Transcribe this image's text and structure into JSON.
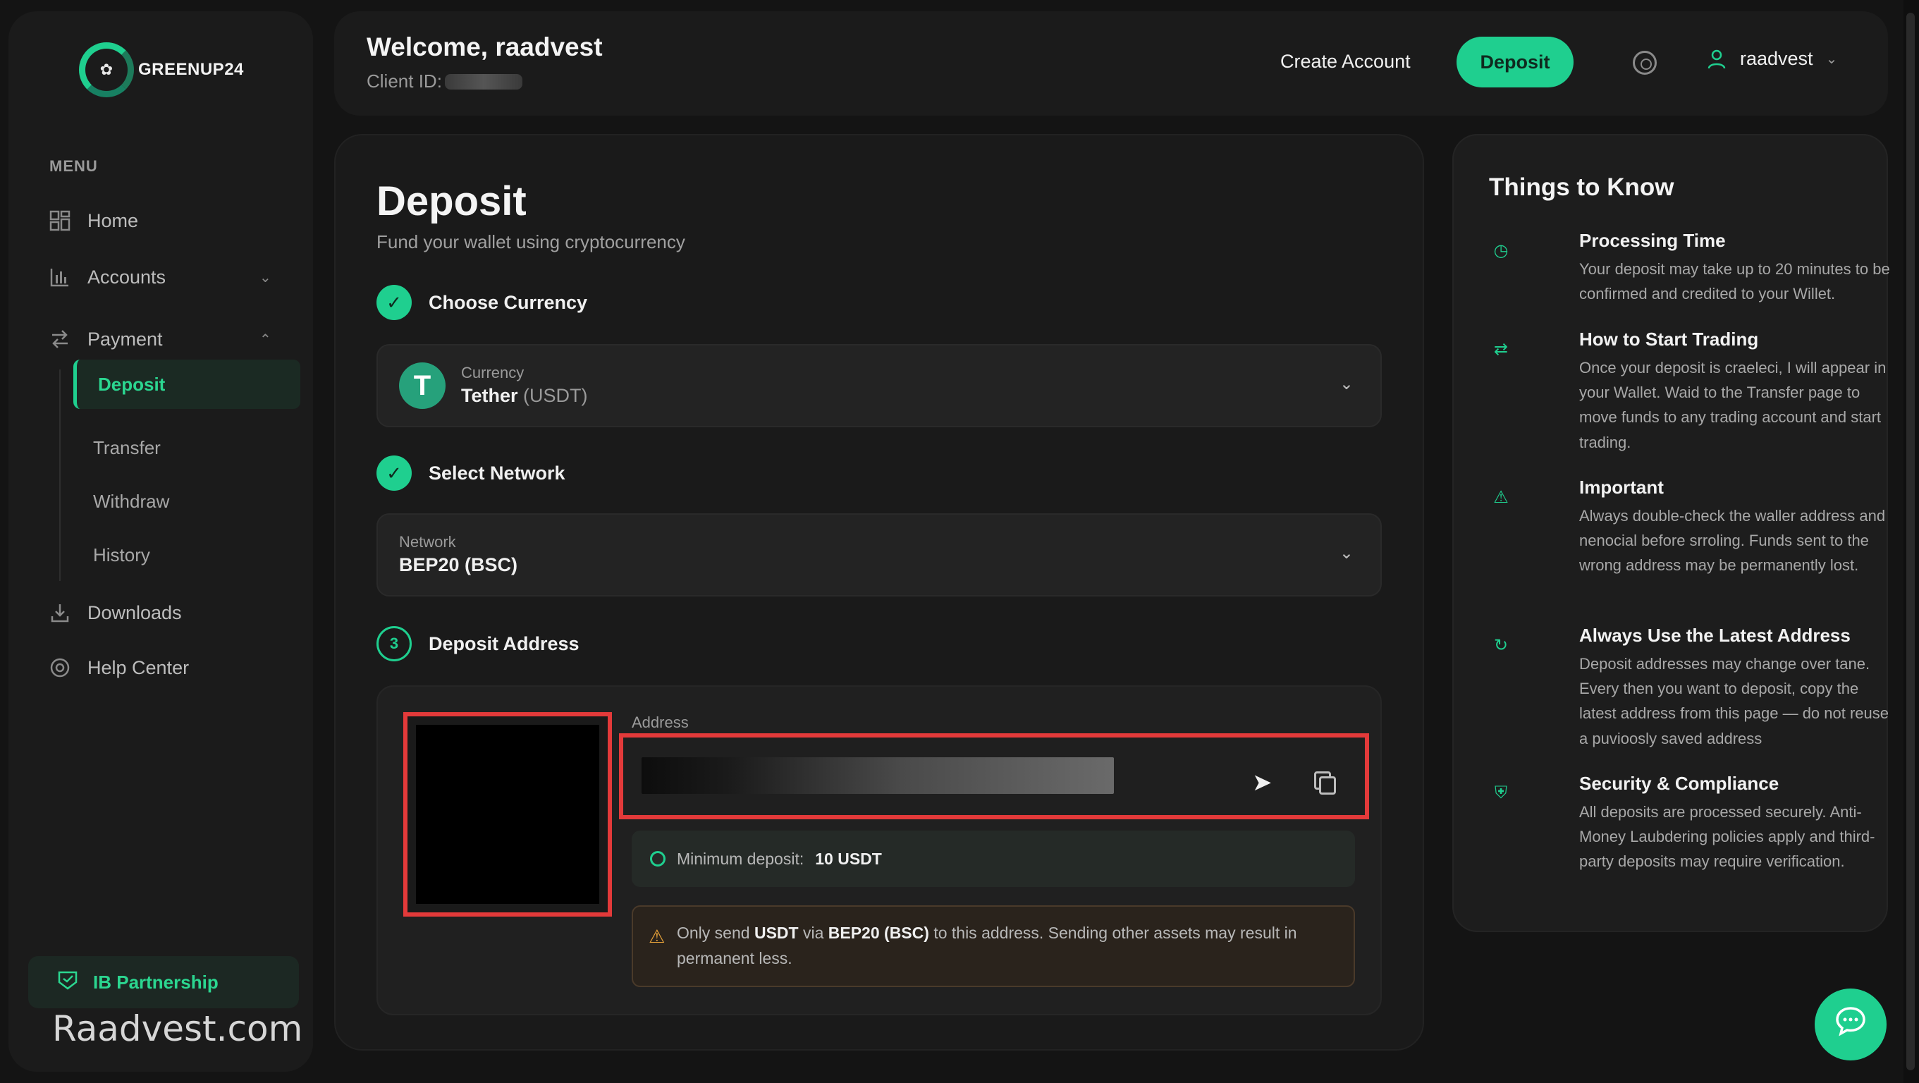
{
  "brand": {
    "name": "GREENUP24"
  },
  "sidebar": {
    "menu_heading": "MENU",
    "items": [
      {
        "label": "Home",
        "icon": "grid-icon"
      },
      {
        "label": "Accounts",
        "icon": "bar-chart-icon"
      },
      {
        "label": "Payment",
        "icon": "transfer-arrows-icon"
      },
      {
        "label": "Downloads",
        "icon": "download-icon"
      },
      {
        "label": "Help Center",
        "icon": "lifebuoy-icon"
      }
    ],
    "payment_sub": [
      {
        "label": "Deposit",
        "active": true
      },
      {
        "label": "Transfer"
      },
      {
        "label": "Withdraw"
      },
      {
        "label": "History"
      }
    ],
    "ib_partnership": "IB Partnership"
  },
  "watermark": "Raadvest.com",
  "header": {
    "welcome": "Welcome, raadvest",
    "client_id_label": "Client ID:",
    "create_account": "Create Account",
    "deposit": "Deposit",
    "username": "raadvest"
  },
  "main": {
    "title": "Deposit",
    "subtitle": "Fund your wallet using cryptocurrency",
    "step1": {
      "label": "Choose Currency",
      "field_label": "Currency",
      "value": "Tether",
      "value_suffix": "(USDT)"
    },
    "step2": {
      "label": "Select Network",
      "field_label": "Network",
      "value": "BEP20 (BSC)"
    },
    "step3": {
      "number": "3",
      "label": "Deposit Address"
    },
    "address": {
      "label": "Address",
      "min_label": "Minimum deposit:",
      "min_value": "10 USDT",
      "warning": {
        "p1": "Only send",
        "asset": "USDT",
        "p2": "via",
        "network": "BEP20 (BSC)",
        "p3": "to this address. Sending other assets may result in permanent less."
      }
    }
  },
  "things_to_know": {
    "title": "Things to Know",
    "items": [
      {
        "title": "Processing Time",
        "desc": "Your deposit may take up to 20 minutes to be confirmed and credited to your Willet.",
        "icon": "clock-icon"
      },
      {
        "title": "How to Start Trading",
        "desc": "Once your deposit is craeleci, I will appear in your Wallet. Waid to the Transfer page to move funds to any trading account and start trading.",
        "icon": "swap-icon"
      },
      {
        "title": "Important",
        "desc": "Always double-check the waller address and nenocial before srroling. Funds sent to the wrong address may be permanently lost.",
        "icon": "alert-icon"
      },
      {
        "title": "Always Use the Latest Address",
        "desc": "Deposit addresses may change over tane. Every then you want to deposit, copy the latest address from this page — do not reuse a puvioosly saved address",
        "icon": "refresh-icon"
      },
      {
        "title": "Security & Compliance",
        "desc": "All deposits are processed securely. Anti-Money Laubdering policies apply and third-party deposits may require verification.",
        "icon": "shield-icon"
      }
    ]
  },
  "colors": {
    "accent": "#1fcf8f",
    "highlight": "#e33a3a",
    "bg": "#141414"
  }
}
